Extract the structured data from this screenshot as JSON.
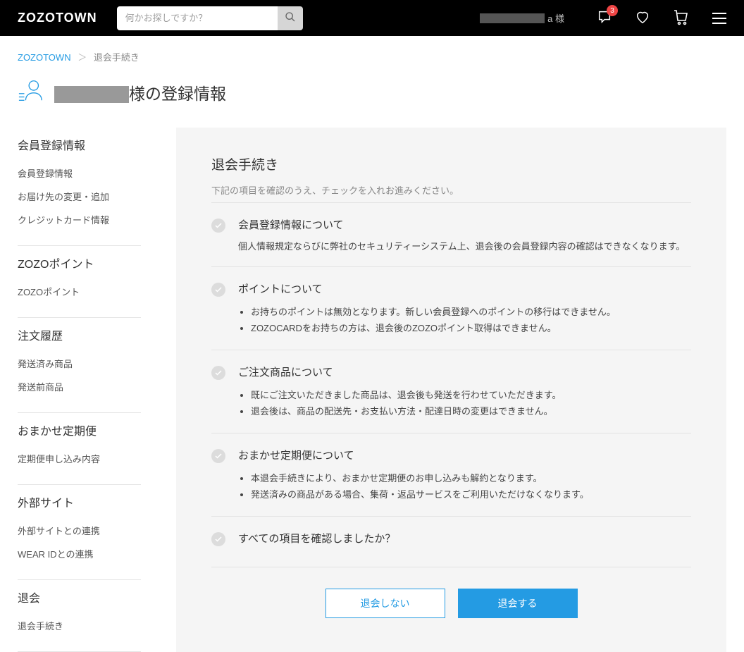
{
  "header": {
    "logo": "ZOZOTOWN",
    "search_placeholder": "何かお探しですか？",
    "username_suffix": "a 様",
    "notif_badge": "3"
  },
  "breadcrumb": {
    "root": "ZOZOTOWN",
    "current": "退会手続き"
  },
  "title_suffix": "様の登録情報",
  "sidebar": [
    {
      "heading": "会員登録情報",
      "items": [
        "会員登録情報",
        "お届け先の変更・追加",
        "クレジットカード情報"
      ]
    },
    {
      "heading": "ZOZOポイント",
      "items": [
        "ZOZOポイント"
      ]
    },
    {
      "heading": "注文履歴",
      "items": [
        "発送済み商品",
        "発送前商品"
      ]
    },
    {
      "heading": "おまかせ定期便",
      "items": [
        "定期便申し込み内容"
      ]
    },
    {
      "heading": "外部サイト",
      "items": [
        "外部サイトとの連携",
        "WEAR IDとの連携"
      ]
    },
    {
      "heading": "退会",
      "items": [
        "退会手続き"
      ]
    }
  ],
  "main": {
    "heading": "退会手続き",
    "lead": "下記の項目を確認のうえ、チェックを入れお進みください。",
    "sections": [
      {
        "title": "会員登録情報について",
        "text": "個人情報規定ならびに弊社のセキュリティーシステム上、退会後の会員登録内容の確認はできなくなります。"
      },
      {
        "title": "ポイントについて",
        "bullets": [
          "お持ちのポイントは無効となります。新しい会員登録へのポイントの移行はできません。",
          "ZOZOCARDをお持ちの方は、退会後のZOZOポイント取得はできません。"
        ]
      },
      {
        "title": "ご注文商品について",
        "bullets": [
          "既にご注文いただきました商品は、退会後も発送を行わせていただきます。",
          "退会後は、商品の配送先・お支払い方法・配達日時の変更はできません。"
        ]
      },
      {
        "title": "おまかせ定期便について",
        "bullets": [
          "本退会手続きにより、おまかせ定期便のお申し込みも解約となります。",
          "発送済みの商品がある場合、集荷・返品サービスをご利用いただけなくなります。"
        ]
      },
      {
        "title": "すべての項目を確認しましたか？"
      }
    ],
    "btn_cancel": "退会しない",
    "btn_submit": "退会する"
  }
}
